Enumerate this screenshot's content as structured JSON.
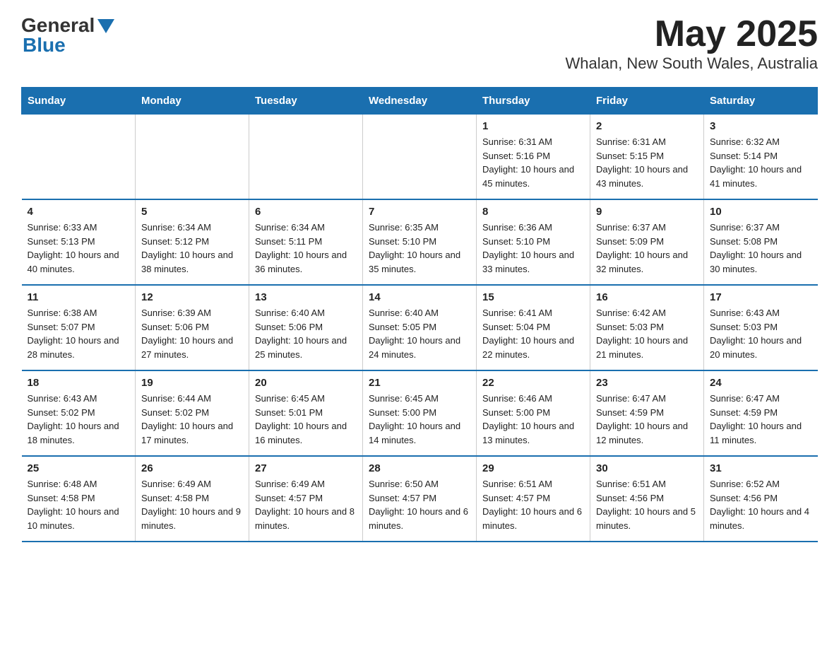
{
  "logo": {
    "general": "General",
    "blue": "Blue"
  },
  "title": "May 2025",
  "subtitle": "Whalan, New South Wales, Australia",
  "days_of_week": [
    "Sunday",
    "Monday",
    "Tuesday",
    "Wednesday",
    "Thursday",
    "Friday",
    "Saturday"
  ],
  "weeks": [
    [
      {
        "day": "",
        "info": ""
      },
      {
        "day": "",
        "info": ""
      },
      {
        "day": "",
        "info": ""
      },
      {
        "day": "",
        "info": ""
      },
      {
        "day": "1",
        "info": "Sunrise: 6:31 AM\nSunset: 5:16 PM\nDaylight: 10 hours and 45 minutes."
      },
      {
        "day": "2",
        "info": "Sunrise: 6:31 AM\nSunset: 5:15 PM\nDaylight: 10 hours and 43 minutes."
      },
      {
        "day": "3",
        "info": "Sunrise: 6:32 AM\nSunset: 5:14 PM\nDaylight: 10 hours and 41 minutes."
      }
    ],
    [
      {
        "day": "4",
        "info": "Sunrise: 6:33 AM\nSunset: 5:13 PM\nDaylight: 10 hours and 40 minutes."
      },
      {
        "day": "5",
        "info": "Sunrise: 6:34 AM\nSunset: 5:12 PM\nDaylight: 10 hours and 38 minutes."
      },
      {
        "day": "6",
        "info": "Sunrise: 6:34 AM\nSunset: 5:11 PM\nDaylight: 10 hours and 36 minutes."
      },
      {
        "day": "7",
        "info": "Sunrise: 6:35 AM\nSunset: 5:10 PM\nDaylight: 10 hours and 35 minutes."
      },
      {
        "day": "8",
        "info": "Sunrise: 6:36 AM\nSunset: 5:10 PM\nDaylight: 10 hours and 33 minutes."
      },
      {
        "day": "9",
        "info": "Sunrise: 6:37 AM\nSunset: 5:09 PM\nDaylight: 10 hours and 32 minutes."
      },
      {
        "day": "10",
        "info": "Sunrise: 6:37 AM\nSunset: 5:08 PM\nDaylight: 10 hours and 30 minutes."
      }
    ],
    [
      {
        "day": "11",
        "info": "Sunrise: 6:38 AM\nSunset: 5:07 PM\nDaylight: 10 hours and 28 minutes."
      },
      {
        "day": "12",
        "info": "Sunrise: 6:39 AM\nSunset: 5:06 PM\nDaylight: 10 hours and 27 minutes."
      },
      {
        "day": "13",
        "info": "Sunrise: 6:40 AM\nSunset: 5:06 PM\nDaylight: 10 hours and 25 minutes."
      },
      {
        "day": "14",
        "info": "Sunrise: 6:40 AM\nSunset: 5:05 PM\nDaylight: 10 hours and 24 minutes."
      },
      {
        "day": "15",
        "info": "Sunrise: 6:41 AM\nSunset: 5:04 PM\nDaylight: 10 hours and 22 minutes."
      },
      {
        "day": "16",
        "info": "Sunrise: 6:42 AM\nSunset: 5:03 PM\nDaylight: 10 hours and 21 minutes."
      },
      {
        "day": "17",
        "info": "Sunrise: 6:43 AM\nSunset: 5:03 PM\nDaylight: 10 hours and 20 minutes."
      }
    ],
    [
      {
        "day": "18",
        "info": "Sunrise: 6:43 AM\nSunset: 5:02 PM\nDaylight: 10 hours and 18 minutes."
      },
      {
        "day": "19",
        "info": "Sunrise: 6:44 AM\nSunset: 5:02 PM\nDaylight: 10 hours and 17 minutes."
      },
      {
        "day": "20",
        "info": "Sunrise: 6:45 AM\nSunset: 5:01 PM\nDaylight: 10 hours and 16 minutes."
      },
      {
        "day": "21",
        "info": "Sunrise: 6:45 AM\nSunset: 5:00 PM\nDaylight: 10 hours and 14 minutes."
      },
      {
        "day": "22",
        "info": "Sunrise: 6:46 AM\nSunset: 5:00 PM\nDaylight: 10 hours and 13 minutes."
      },
      {
        "day": "23",
        "info": "Sunrise: 6:47 AM\nSunset: 4:59 PM\nDaylight: 10 hours and 12 minutes."
      },
      {
        "day": "24",
        "info": "Sunrise: 6:47 AM\nSunset: 4:59 PM\nDaylight: 10 hours and 11 minutes."
      }
    ],
    [
      {
        "day": "25",
        "info": "Sunrise: 6:48 AM\nSunset: 4:58 PM\nDaylight: 10 hours and 10 minutes."
      },
      {
        "day": "26",
        "info": "Sunrise: 6:49 AM\nSunset: 4:58 PM\nDaylight: 10 hours and 9 minutes."
      },
      {
        "day": "27",
        "info": "Sunrise: 6:49 AM\nSunset: 4:57 PM\nDaylight: 10 hours and 8 minutes."
      },
      {
        "day": "28",
        "info": "Sunrise: 6:50 AM\nSunset: 4:57 PM\nDaylight: 10 hours and 6 minutes."
      },
      {
        "day": "29",
        "info": "Sunrise: 6:51 AM\nSunset: 4:57 PM\nDaylight: 10 hours and 6 minutes."
      },
      {
        "day": "30",
        "info": "Sunrise: 6:51 AM\nSunset: 4:56 PM\nDaylight: 10 hours and 5 minutes."
      },
      {
        "day": "31",
        "info": "Sunrise: 6:52 AM\nSunset: 4:56 PM\nDaylight: 10 hours and 4 minutes."
      }
    ]
  ]
}
